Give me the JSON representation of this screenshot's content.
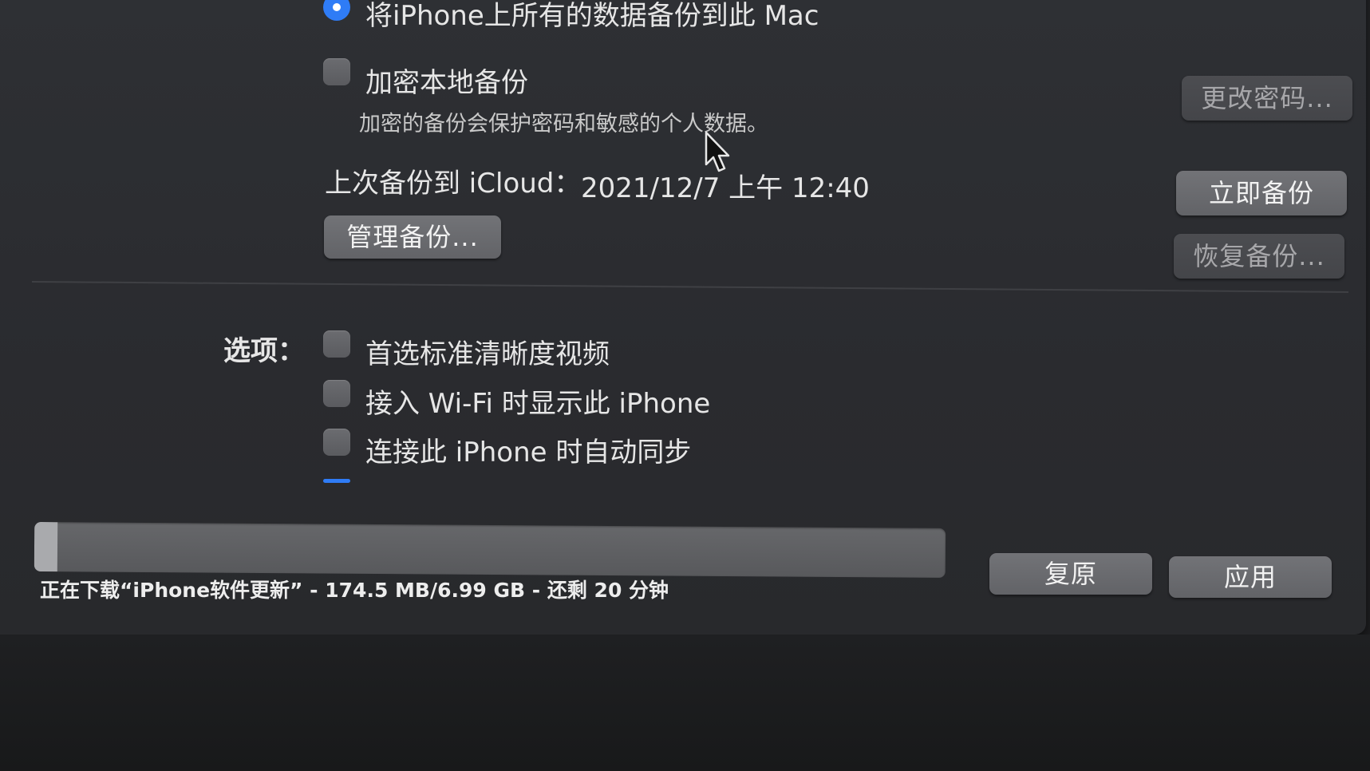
{
  "backup": {
    "radio_label": "将iPhone上所有的数据备份到此 Mac",
    "encrypt_label": "加密本地备份",
    "encrypt_note": "加密的备份会保护密码和敏感的个人数据。",
    "last_backup_label": "上次备份到 iCloud：",
    "last_backup_time": "2021/12/7 上午 12:40",
    "manage_button": "管理备份...",
    "change_password_button": "更改密码...",
    "backup_now_button": "立即备份",
    "restore_backup_button": "恢复备份..."
  },
  "options": {
    "label": "选项：",
    "items": [
      {
        "label": "首选标准清晰度视频",
        "checked": false
      },
      {
        "label": "接入 Wi-Fi 时显示此 iPhone",
        "checked": false
      },
      {
        "label": "连接此 iPhone 时自动同步",
        "checked": false
      }
    ]
  },
  "footer": {
    "progress_fraction": 0.025,
    "status_text": "正在下载“iPhone软件更新” - 174.5 MB/6.99 GB - 还剩 20 分钟",
    "revert_button": "复原",
    "apply_button": "应用"
  },
  "colors": {
    "accent": "#2f7cf6"
  }
}
